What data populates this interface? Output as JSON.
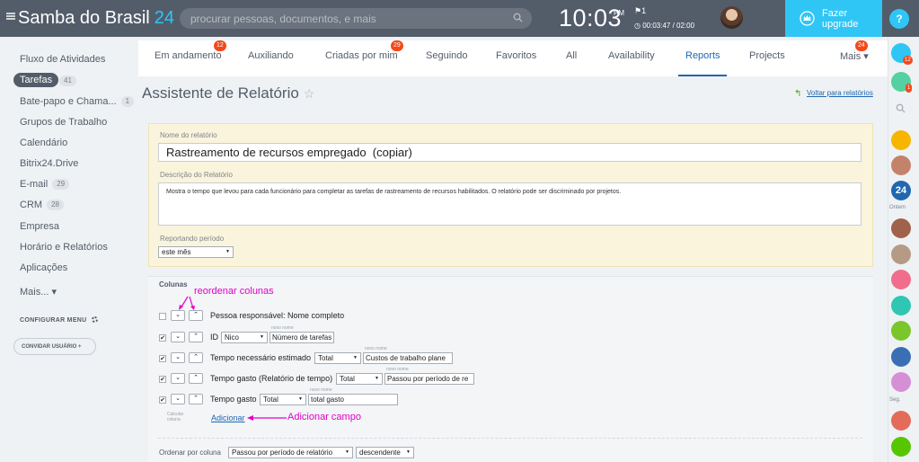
{
  "header": {
    "logo": "Samba do Brasil",
    "logo_num": "24",
    "search_placeholder": "procurar pessoas, documentos, e mais",
    "clock": "10:03",
    "ampm": "PM",
    "flag_count": "1",
    "timer": "00:03:47 / 02:00",
    "upgrade_label": "Fazer upgrade",
    "help": "?"
  },
  "sidebar": {
    "items": [
      {
        "label": "Fluxo de Atividades"
      },
      {
        "label": "Tarefas",
        "count": "41"
      },
      {
        "label": "Bate-papo e Chama...",
        "count": "1"
      },
      {
        "label": "Grupos de Trabalho"
      },
      {
        "label": "Calendário"
      },
      {
        "label": "Bitrix24.Drive"
      },
      {
        "label": "E-mail",
        "count": "29"
      },
      {
        "label": "CRM",
        "count": "28"
      },
      {
        "label": "Empresa"
      },
      {
        "label": "Horário e Relatórios"
      },
      {
        "label": "Aplicações"
      },
      {
        "label": "Mais... ▾"
      }
    ],
    "configure": "CONFIGURAR MENU",
    "invite": "CONVIDAR USUÁRIO  +"
  },
  "tabs": [
    {
      "label": "Em andamento",
      "badge": "12"
    },
    {
      "label": "Auxiliando"
    },
    {
      "label": "Criadas por mim",
      "badge": "29"
    },
    {
      "label": "Seguindo"
    },
    {
      "label": "Favoritos"
    },
    {
      "label": "All"
    },
    {
      "label": "Availability"
    },
    {
      "label": "Reports"
    },
    {
      "label": "Projects"
    },
    {
      "label": "Mais ▾",
      "badge": "24"
    }
  ],
  "page": {
    "title": "Assistente de Relatório",
    "back_link": "Voltar para relatórios"
  },
  "form": {
    "name_label": "Nome do relatório",
    "name_value": "Rastreamento de recursos empregado  (copiar)",
    "desc_label": "Descrição do Relatório",
    "desc_value": "Mostra o tempo que levou para cada funcionário para completar as tarefas de rastreamento de recursos habilitados. O relatório pode ser discriminado por projetos.",
    "period_label": "Reportando período",
    "period_value": "este mês",
    "columns_title": "Colunas",
    "annotation_reorder": "reordenar colunas",
    "annotation_add": "Adicionar campo",
    "new_name": "novo nome",
    "rows": [
      {
        "label": "Pessoa responsável: Nome completo",
        "checked": false
      },
      {
        "label": "ID",
        "agg": "Nico",
        "alias": "Número de tarefas",
        "checked": true
      },
      {
        "label": "Tempo necessário estimado",
        "agg": "Total",
        "alias": "Custos de trabalho plane",
        "checked": true
      },
      {
        "label": "Tempo gasto (Relatório de tempo)",
        "agg": "Total",
        "alias": "Passou por período de re",
        "checked": true
      },
      {
        "label": "Tempo gasto",
        "agg": "Total",
        "alias": "total gasto",
        "checked": true
      }
    ],
    "calc_note_1": "Calcular",
    "calc_note_2": "coluna",
    "add_label": "Adicionar",
    "order_label": "Ordenar por coluna",
    "order_value": "Passou por período de relatório",
    "order_dir": "descendente"
  },
  "rightbar": {
    "badge_1": "12",
    "badge_2": "1",
    "label_ontem": "Ontem",
    "label_seg": "Seg."
  },
  "colors": {
    "topbar": "#535c69",
    "accent": "#2fc6f6",
    "link": "#2067b0",
    "badge": "#f54819",
    "annotation": "#e100c8"
  }
}
